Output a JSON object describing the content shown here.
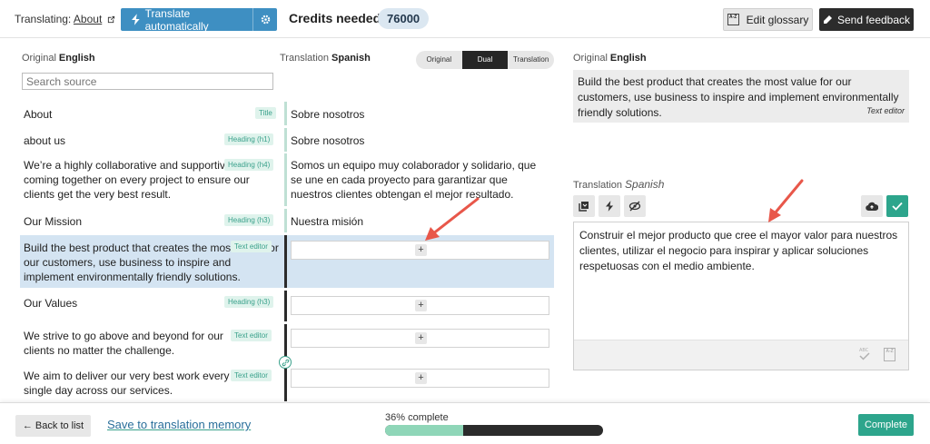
{
  "topbar": {
    "translating_label": "Translating:",
    "page_link": "About",
    "auto_translate_label": "Translate automatically",
    "credits_label": "Credits needed",
    "credits_value": "76000",
    "edit_glossary_label": "Edit glossary",
    "send_feedback_label": "Send feedback"
  },
  "source": {
    "heading_prefix": "Original",
    "language": "English",
    "search_placeholder": "Search source"
  },
  "target": {
    "heading_prefix": "Translation",
    "language": "Spanish"
  },
  "view_toggle": {
    "options": [
      "Original",
      "Dual",
      "Translation"
    ],
    "active": "Dual"
  },
  "rows": [
    {
      "source": "About",
      "tag": "Title",
      "translation": "Sobre nosotros"
    },
    {
      "source": "about us",
      "tag": "Heading (h1)",
      "translation": "Sobre nosotros"
    },
    {
      "source": "We’re a highly collaborative and supportive team, coming together on every project to ensure our clients get the very best result.",
      "tag": "Heading (h4)",
      "translation": "Somos un equipo muy colaborador y solidario, que se une en cada proyecto para garantizar que nuestros clientes obtengan el mejor resultado."
    },
    {
      "source": "Our Mission",
      "tag": "Heading (h3)",
      "translation": "Nuestra misión"
    },
    {
      "source": "Build the best product that creates the most value for our customers, use business to inspire and implement environmentally friendly solutions.",
      "tag": "Text editor",
      "translation": ""
    },
    {
      "source": "Our Values",
      "tag": "Heading (h3)",
      "translation": ""
    },
    {
      "source": "We strive to go above and beyond for our clients no matter the challenge.",
      "tag": "Text editor",
      "translation": ""
    },
    {
      "source": "We aim to deliver our very best work every single day across our services.",
      "tag": "Text editor",
      "translation": ""
    }
  ],
  "plus_label": "+",
  "detail": {
    "original_prefix": "Original",
    "original_language": "English",
    "original_text": "Build the best product that creates the most value for our customers, use business to inspire and implement environmentally friendly solutions.",
    "original_type": "Text editor",
    "translation_prefix": "Translation",
    "translation_language": "Spanish",
    "translation_text": "Construir el mejor producto que cree el mayor valor para nuestros clientes, utilizar el negocio para inspirar y aplicar soluciones respetuosas con el medio ambiente."
  },
  "bottombar": {
    "back_label": "← Back to list",
    "save_memory_label": "Save to translation memory",
    "progress_label": "36% complete",
    "progress_percent": 36,
    "complete_label": "Complete"
  },
  "colors": {
    "accent_blue": "#3e8fc2",
    "accent_green": "#2da58c",
    "selected_row": "#d4e4f2",
    "arrow_red": "#e8574a"
  }
}
